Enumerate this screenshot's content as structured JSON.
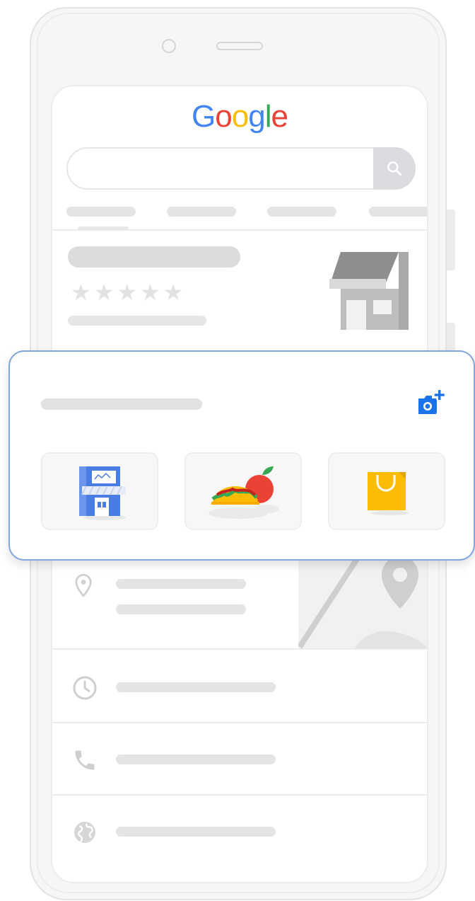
{
  "logo": {
    "letters": [
      "G",
      "o",
      "o",
      "g",
      "l",
      "e"
    ],
    "colors": [
      "#4285F4",
      "#EA4335",
      "#FBBC05",
      "#4285F4",
      "#34A853",
      "#EA4335"
    ]
  },
  "search": {
    "value": "",
    "placeholder": ""
  },
  "business": {
    "stars": "★★★★★"
  },
  "colors": {
    "accent": "#1A73E8",
    "card_border": "#7FA6DD",
    "placeholder_gray": "#E4E4E4"
  },
  "card": {
    "icons": [
      "add-photo-icon",
      "storefront-icon",
      "food-icon",
      "shopping-bag-icon"
    ]
  },
  "details": {
    "icons": [
      "location-pin-icon",
      "clock-icon",
      "phone-icon",
      "globe-icon"
    ]
  }
}
